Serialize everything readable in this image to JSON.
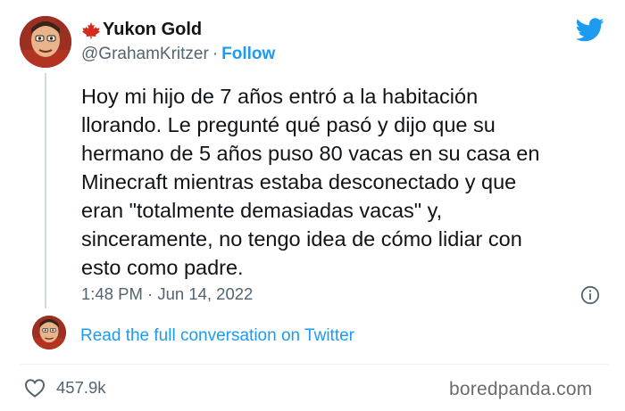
{
  "author": {
    "display_name": "Yukon Gold",
    "handle": "@GrahamKritzer",
    "separator": "·",
    "follow_label": "Follow",
    "flag_icon": "maple-leaf-icon"
  },
  "tweet": {
    "lines": [
      "Hoy mi hijo de 7 años entró a la habitación",
      "llorando. Le pregunté qué pasó y dijo que su",
      "hermano de 5 años puso 80 vacas en su casa en",
      "Minecraft mientras estaba desconectado y que",
      "eran \"totalmente demasiadas vacas\" y,",
      "sinceramente, no tengo idea de cómo lidiar con",
      "esto como padre."
    ],
    "time": "1:48 PM",
    "date": "Jun 14, 2022",
    "separator": "·"
  },
  "conversation": {
    "link_label": "Read the full conversation on Twitter"
  },
  "footer": {
    "likes": "457.9k",
    "watermark": "boredpanda.com"
  },
  "colors": {
    "accent": "#1d9bf0",
    "text": "#0f1419",
    "muted": "#536471",
    "flag": "#d52b1e"
  }
}
